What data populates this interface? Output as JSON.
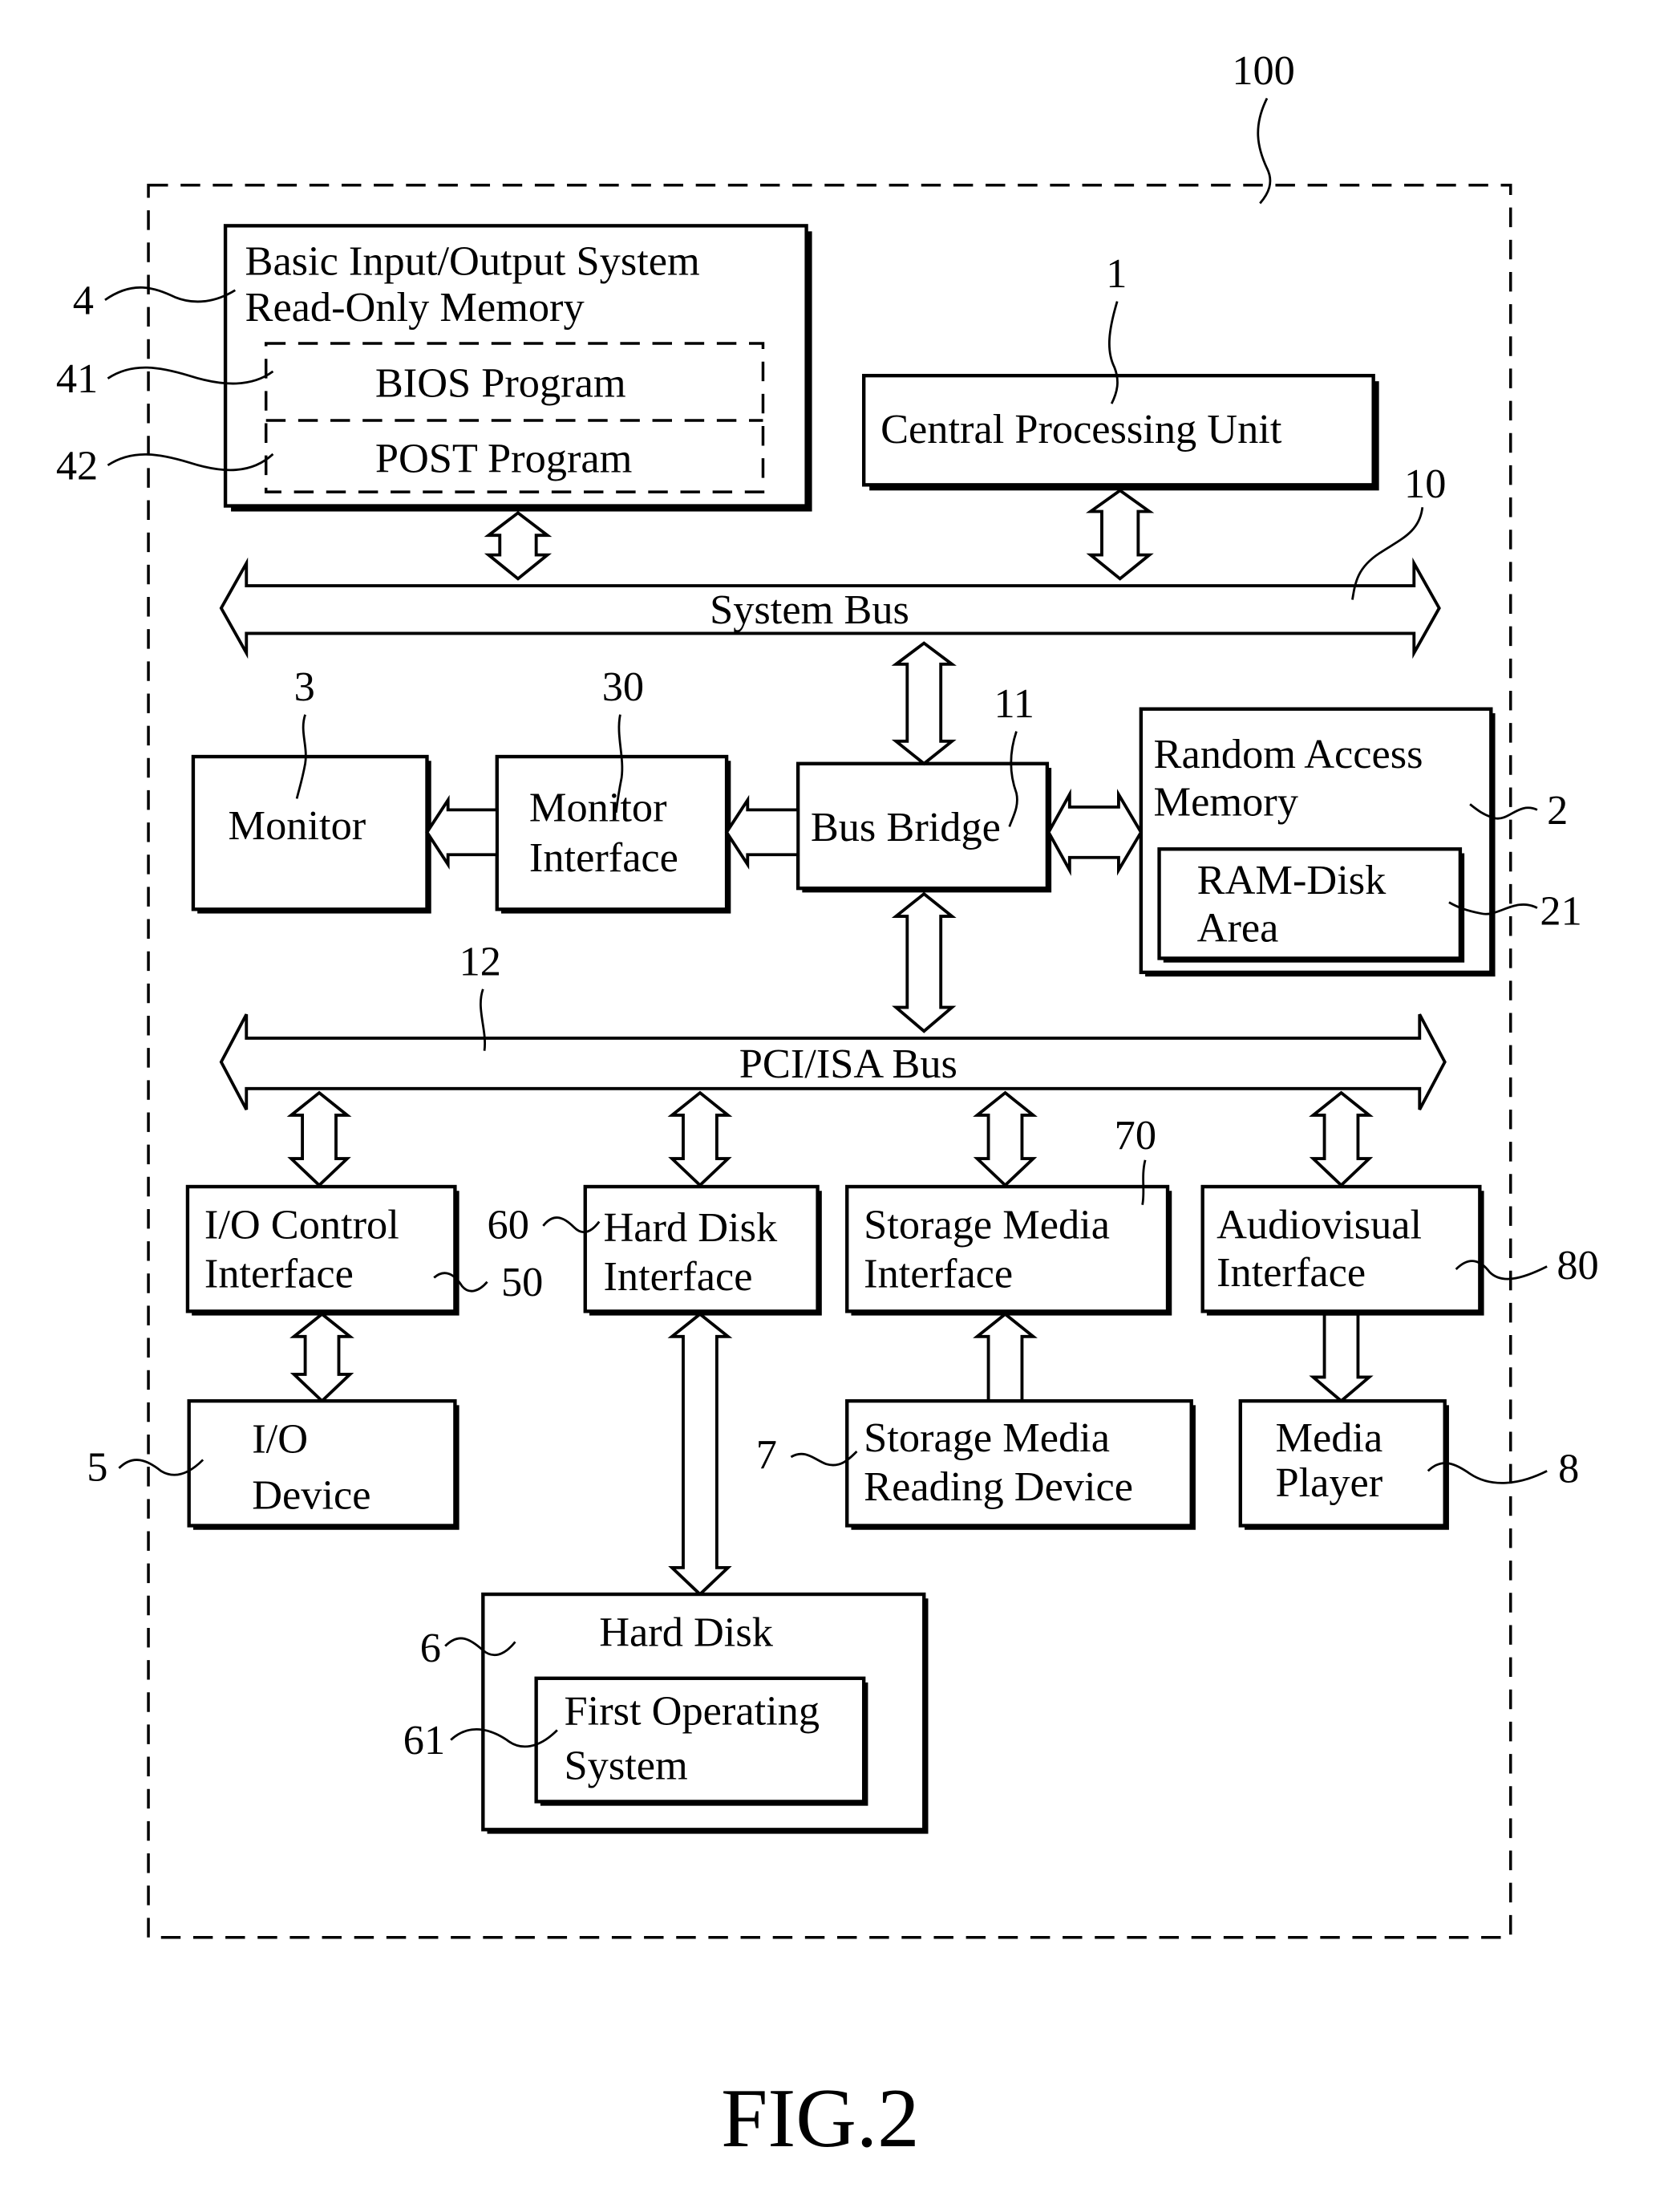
{
  "figure": {
    "caption": "FIG.2",
    "system_ref": "100"
  },
  "blocks": {
    "bios_rom": {
      "ref": "4",
      "line1": "Basic Input/Output System",
      "line2": "Read-Only Memory"
    },
    "bios_program": {
      "ref": "41",
      "label": "BIOS Program"
    },
    "post_program": {
      "ref": "42",
      "label": "POST Program"
    },
    "cpu": {
      "ref": "1",
      "label": "Central Processing Unit"
    },
    "system_bus": {
      "ref": "10",
      "label": "System Bus"
    },
    "monitor": {
      "ref": "3",
      "label": "Monitor"
    },
    "monitor_interface": {
      "ref": "30",
      "line1": "Monitor",
      "line2": "Interface"
    },
    "bus_bridge": {
      "ref": "11",
      "label": "Bus Bridge"
    },
    "ram": {
      "ref": "2",
      "line1": "Random Access",
      "line2": "Memory"
    },
    "ram_disk": {
      "ref": "21",
      "line1": "RAM-Disk",
      "line2": "Area"
    },
    "pci_bus": {
      "ref": "12",
      "label": "PCI/ISA Bus"
    },
    "io_control": {
      "ref": "50",
      "line1": "I/O Control",
      "line2": "Interface"
    },
    "hdd_interface": {
      "ref": "60",
      "line1": "Hard Disk",
      "line2": "Interface"
    },
    "storage_interface": {
      "ref": "70",
      "line1": "Storage Media",
      "line2": "Interface"
    },
    "av_interface": {
      "ref": "80",
      "line1": "Audiovisual",
      "line2": "Interface"
    },
    "io_device": {
      "ref": "5",
      "line1": "I/O",
      "line2": "Device"
    },
    "storage_reader": {
      "ref": "7",
      "line1": "Storage Media",
      "line2": "Reading Device"
    },
    "media_player": {
      "ref": "8",
      "line1": "Media",
      "line2": "Player"
    },
    "hard_disk": {
      "ref": "6",
      "label": "Hard Disk"
    },
    "first_os": {
      "ref": "61",
      "line1": "First Operating",
      "line2": "System"
    }
  }
}
